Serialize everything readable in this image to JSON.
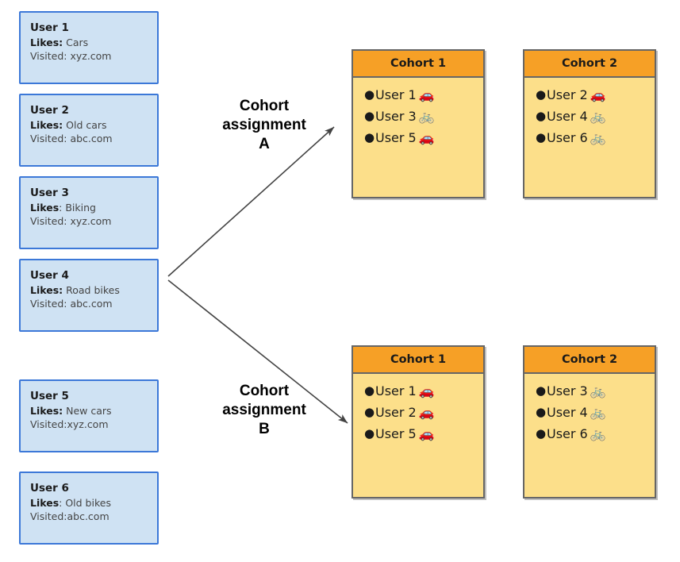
{
  "users": {
    "label_likes": "Likes:",
    "label_likes_alt": "Likes",
    "label_visited": "Visited:",
    "items": [
      {
        "name": "User 1",
        "likes_label": "Likes:",
        "likes": " Cars",
        "visited_label": "Visited:",
        "visited": " xyz.com"
      },
      {
        "name": "User 2",
        "likes_label": "Likes:",
        "likes": " Old cars",
        "visited_label": "Visited:",
        "visited": " abc.com"
      },
      {
        "name": "User 3",
        "likes_label": "Likes",
        "likes": ": Biking",
        "visited_label": "Visited:",
        "visited": " xyz.com"
      },
      {
        "name": "User 4",
        "likes_label": "Likes:",
        "likes": " Road bikes",
        "visited_label": "Visited:",
        "visited": " abc.com"
      },
      {
        "name": "User 5",
        "likes_label": "Likes:",
        "likes": " New cars",
        "visited_label": "Visited:",
        "visited": "xyz.com"
      },
      {
        "name": "User 6",
        "likes_label": "Likes",
        "likes": ": Old bikes",
        "visited_label": "Visited:",
        "visited": "abc.com"
      }
    ]
  },
  "assignments": [
    {
      "id": "A",
      "label": "Cohort\nassignment\nA",
      "cohorts": [
        {
          "title": "Cohort 1",
          "members": [
            {
              "bullet": "●",
              "label": "User 1",
              "icon": "car-emoji",
              "emoji": "🚗"
            },
            {
              "bullet": "●",
              "label": "User 3",
              "icon": "bicycle-emoji",
              "emoji": "🚲"
            },
            {
              "bullet": "●",
              "label": "User 5",
              "icon": "car-emoji",
              "emoji": "🚗"
            }
          ]
        },
        {
          "title": "Cohort 2",
          "members": [
            {
              "bullet": "●",
              "label": "User 2",
              "icon": "car-emoji",
              "emoji": "🚗"
            },
            {
              "bullet": "●",
              "label": "User 4",
              "icon": "bicycle-emoji",
              "emoji": "🚲"
            },
            {
              "bullet": "●",
              "label": "User 6",
              "icon": "bicycle-emoji",
              "emoji": "🚲"
            }
          ]
        }
      ]
    },
    {
      "id": "B",
      "label": "Cohort\nassignment\nB",
      "cohorts": [
        {
          "title": "Cohort 1",
          "members": [
            {
              "bullet": "●",
              "label": "User 1",
              "icon": "car-emoji",
              "emoji": "🚗"
            },
            {
              "bullet": "●",
              "label": "User 2",
              "icon": "car-emoji",
              "emoji": "🚗"
            },
            {
              "bullet": "●",
              "label": "User 5",
              "icon": "car-emoji",
              "emoji": "🚗"
            }
          ]
        },
        {
          "title": "Cohort 2",
          "members": [
            {
              "bullet": "●",
              "label": "User 3",
              "icon": "bicycle-emoji",
              "emoji": "🚲"
            },
            {
              "bullet": "●",
              "label": "User 4",
              "icon": "bicycle-emoji",
              "emoji": "🚲"
            },
            {
              "bullet": "●",
              "label": "User 6",
              "icon": "bicycle-emoji",
              "emoji": "🚲"
            }
          ]
        }
      ]
    }
  ],
  "colors": {
    "user_card_fill": "#cfe2f3",
    "user_card_border": "#3c78d8",
    "cohort_header_fill": "#f6a026",
    "cohort_body_fill": "#fcdf8a",
    "cohort_border": "#666666",
    "arrow_stroke": "#434343",
    "text": "#1a1a1a",
    "background": "#ffffff"
  }
}
